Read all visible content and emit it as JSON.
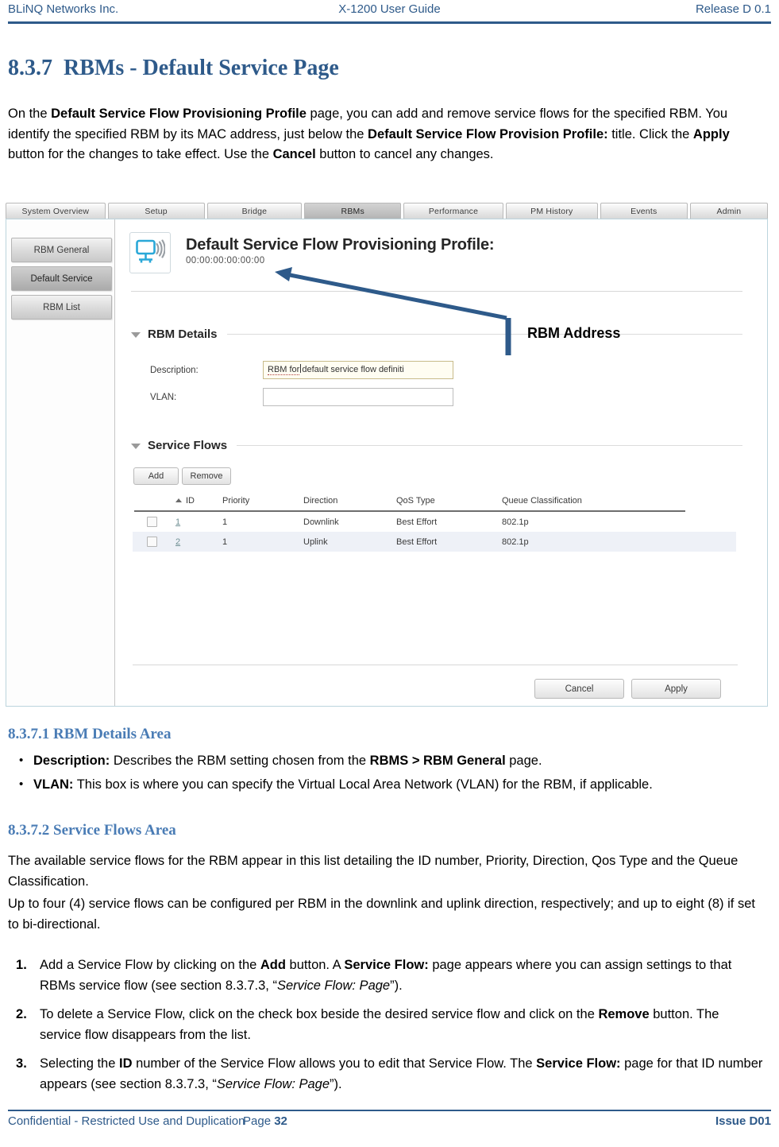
{
  "header": {
    "left": "BLiNQ Networks Inc.",
    "center": "X-1200 User Guide",
    "right": "Release D 0.1"
  },
  "section": {
    "number": "8.3.7",
    "title": "RBMs - Default Service Page",
    "intro_1": "On the ",
    "intro_b1": "Default Service Flow Provisioning Profile",
    "intro_2": " page, you can add and remove service flows for the specified RBM. You identify the specified RBM by its MAC address, just below the ",
    "intro_b2": "Default Service Flow Provision Profile:",
    "intro_3": " title. Click the ",
    "intro_b3": "Apply",
    "intro_4": " button for the changes to take effect. Use the ",
    "intro_b4": "Cancel",
    "intro_5": " button to cancel any changes."
  },
  "figure": {
    "tabs": [
      "System Overview",
      "Setup",
      "Bridge",
      "RBMs",
      "Performance",
      "PM History",
      "Events",
      "Admin"
    ],
    "active_tab": "RBMs",
    "sidebar": [
      "RBM General",
      "Default Service",
      "RBM List"
    ],
    "sidebar_active": "Default Service",
    "device_icon": "wireless-monitor-icon",
    "page_title": "Default Service Flow Provisioning Profile:",
    "mac_address": "00:00:00:00:00:00",
    "rbm_details": {
      "section_label": "RBM Details",
      "description_label": "Description:",
      "description_value_a": "RBM for",
      "description_value_b": "default service flow definiti",
      "vlan_label": "VLAN:",
      "vlan_value": ""
    },
    "service_flows": {
      "section_label": "Service Flows",
      "add_label": "Add",
      "remove_label": "Remove",
      "columns": [
        "ID",
        "Priority",
        "Direction",
        "QoS Type",
        "Queue Classification"
      ],
      "rows": [
        {
          "id": "1",
          "priority": "1",
          "direction": "Downlink",
          "qos": "Best Effort",
          "queue": "802.1p"
        },
        {
          "id": "2",
          "priority": "1",
          "direction": "Uplink",
          "qos": "Best Effort",
          "queue": "802.1p"
        }
      ]
    },
    "footer_buttons": {
      "cancel": "Cancel",
      "apply": "Apply"
    },
    "annotation": "RBM Address"
  },
  "sub1": {
    "heading": "8.3.7.1 RBM Details Area",
    "bullets": [
      {
        "term": "Description:",
        "text_a": " Describes the RBM setting chosen from the ",
        "bold": "RBMS > RBM General",
        "text_b": " page."
      },
      {
        "term": "VLAN:",
        "text_a": " This box is where you can specify the Virtual Local Area Network (VLAN) for the RBM, if applicable.",
        "bold": "",
        "text_b": ""
      }
    ]
  },
  "sub2": {
    "heading": "8.3.7.2 Service Flows Area",
    "para_1": "The available service flows for the RBM appear in this list detailing the ID number, Priority, Direction, Qos Type and the Queue Classification.",
    "para_2": "Up to four (4) service flows can be configured per RBM in the downlink and uplink direction, respectively; and up to eight (8) if set to bi-directional.",
    "steps": [
      {
        "a": "Add a Service Flow by clicking on the ",
        "b1": "Add",
        "c": " button. A ",
        "b2": "Service Flow:",
        "d": " page appears where you can assign settings to that RBMs service flow (see section 8.3.7.3, “",
        "i": "Service Flow: Page",
        "e": "”)."
      },
      {
        "a": "To delete a Service Flow, click on the check box beside the desired service flow and click on the ",
        "b1": "Remove",
        "c": " button. The service flow disappears from the list.",
        "b2": "",
        "d": "",
        "i": "",
        "e": ""
      },
      {
        "a": "Selecting the ",
        "b1": "ID",
        "c": " number of the Service Flow allows you to edit that Service Flow. The ",
        "b2": "Service Flow:",
        "d": " page for that ID number appears (see section 8.3.7.3, “",
        "i": "Service Flow: Page",
        "e": "”)."
      }
    ]
  },
  "footer": {
    "left": "Confidential - Restricted Use and Duplication",
    "page_label": "Page ",
    "page_number": "32",
    "right": "Issue D01"
  },
  "colors": {
    "accent_blue": "#2e5a8a",
    "heading_blue": "#4a7cb5",
    "annotation_blue": "#2e5a8a",
    "row_alt": "#eef1f7"
  }
}
